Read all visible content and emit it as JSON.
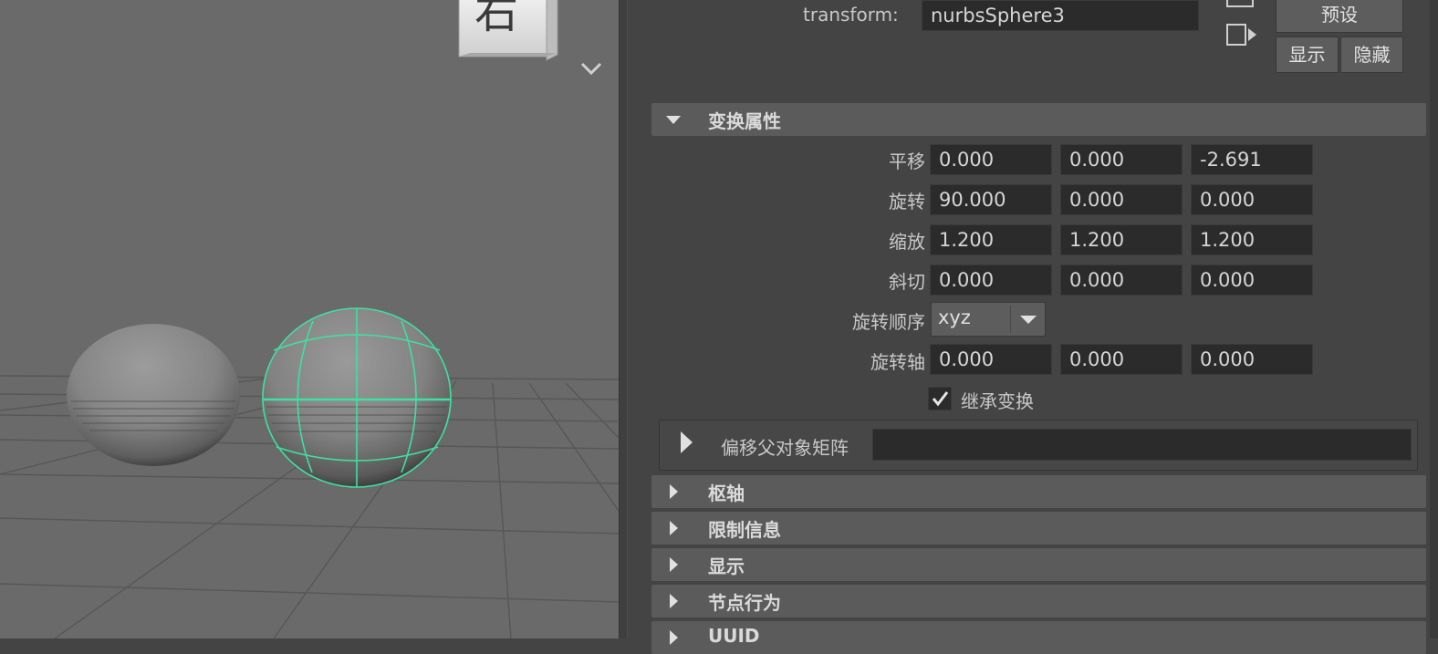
{
  "viewport": {
    "viewcube_face_label": "右"
  },
  "header": {
    "transform_label": "transform:",
    "transform_value": "nurbsSphere3",
    "preset_button": "预设",
    "show_button": "显示",
    "hide_button": "隐藏"
  },
  "sections": {
    "transform_attrs": "变换属性",
    "pivots": "枢轴",
    "limit_info": "限制信息",
    "display": "显示",
    "node_behavior": "节点行为",
    "uuid": "UUID",
    "offset_parent_matrix": "偏移父对象矩阵"
  },
  "attributes": {
    "translate": {
      "label": "平移",
      "values": [
        "0.000",
        "0.000",
        "-2.691"
      ]
    },
    "rotate": {
      "label": "旋转",
      "values": [
        "90.000",
        "0.000",
        "0.000"
      ]
    },
    "scale": {
      "label": "缩放",
      "values": [
        "1.200",
        "1.200",
        "1.200"
      ]
    },
    "shear": {
      "label": "斜切",
      "values": [
        "0.000",
        "0.000",
        "0.000"
      ]
    },
    "rotate_order": {
      "label": "旋转顺序",
      "value": "xyz"
    },
    "rotate_axis": {
      "label": "旋转轴",
      "values": [
        "0.000",
        "0.000",
        "0.000"
      ]
    },
    "inherits_transform": {
      "label": "继承变换",
      "checked": true
    }
  },
  "colors": {
    "selection_wire": "#3fe0a0",
    "viewport_bg": "#6a6a6a",
    "panel_bg": "#444444",
    "field_bg": "#2b2b2b"
  }
}
